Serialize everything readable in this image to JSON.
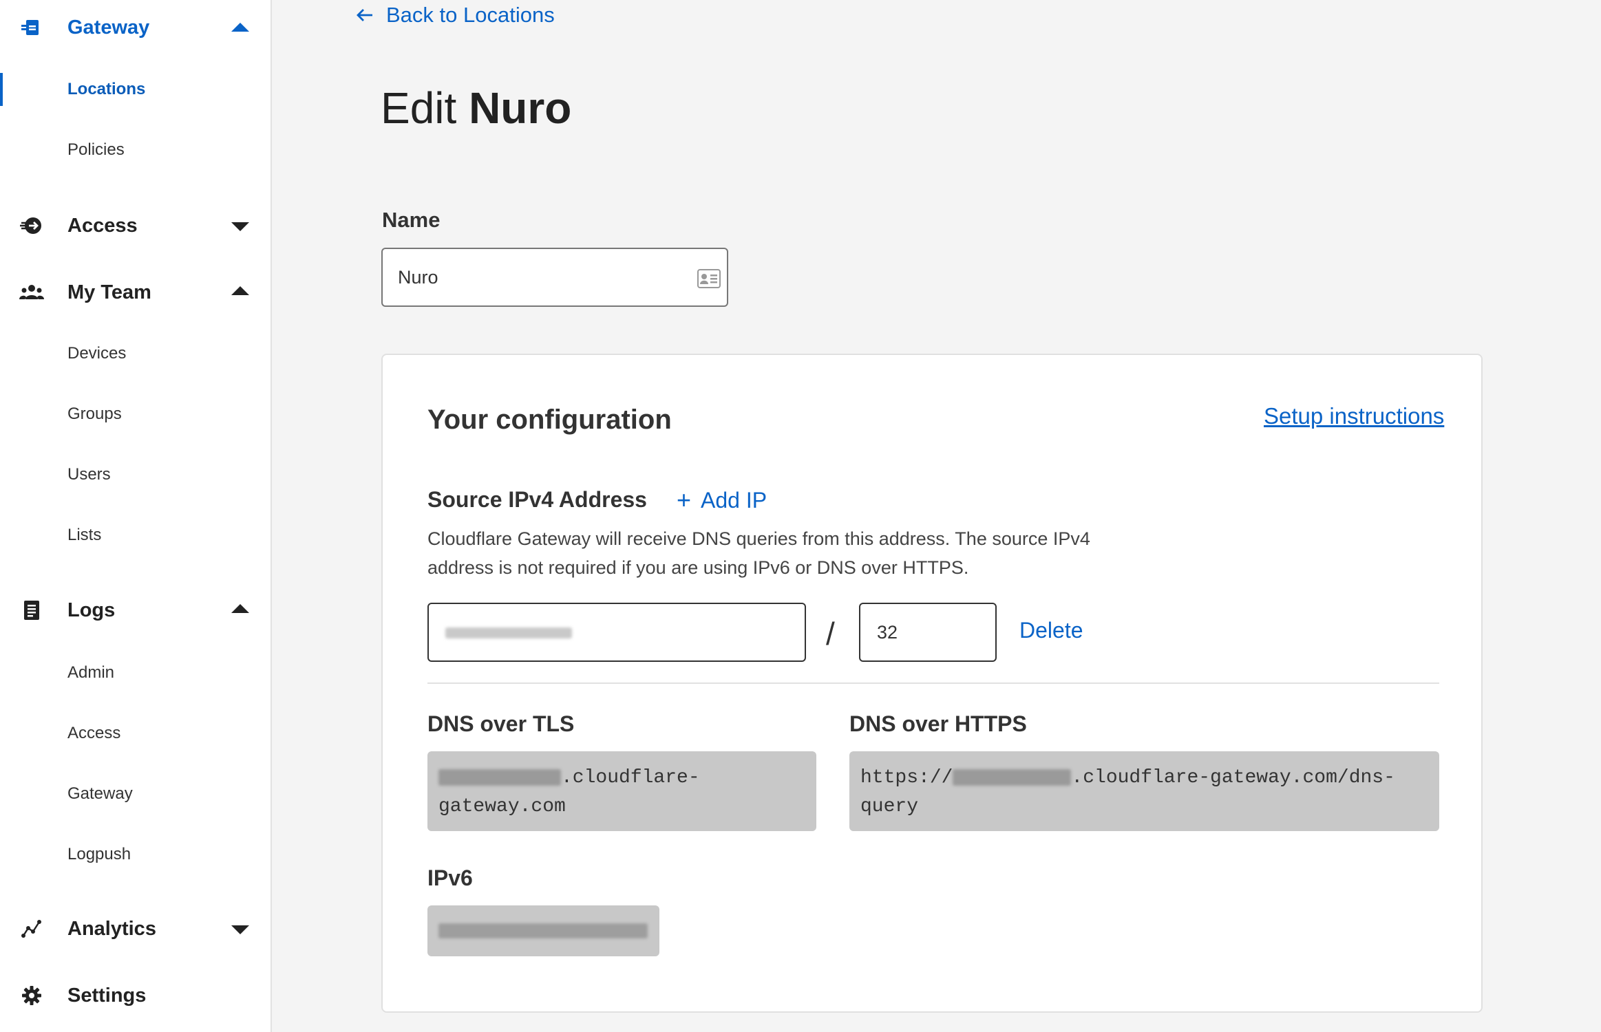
{
  "sidebar": {
    "gateway": {
      "label": "Gateway",
      "icon": "gateway-icon",
      "expanded": true,
      "items": [
        {
          "label": "Locations",
          "active": true
        },
        {
          "label": "Policies"
        }
      ]
    },
    "access": {
      "label": "Access",
      "icon": "access-icon",
      "expanded": false
    },
    "my_team": {
      "label": "My Team",
      "icon": "team-icon",
      "expanded": true,
      "items": [
        {
          "label": "Devices"
        },
        {
          "label": "Groups"
        },
        {
          "label": "Users"
        },
        {
          "label": "Lists"
        }
      ]
    },
    "logs": {
      "label": "Logs",
      "icon": "logs-icon",
      "expanded": true,
      "items": [
        {
          "label": "Admin"
        },
        {
          "label": "Access"
        },
        {
          "label": "Gateway"
        },
        {
          "label": "Logpush"
        }
      ]
    },
    "analytics": {
      "label": "Analytics",
      "icon": "analytics-icon",
      "expanded": false
    },
    "settings": {
      "label": "Settings",
      "icon": "gear-icon"
    }
  },
  "main": {
    "back_link": "Back to Locations",
    "title_prefix": "Edit",
    "title_name": "Nuro",
    "name_label": "Name",
    "name_value": "Nuro",
    "config": {
      "title": "Your configuration",
      "setup_link": "Setup instructions",
      "source_label": "Source IPv4 Address",
      "add_ip": "Add IP",
      "description": "Cloudflare Gateway will receive DNS queries from this address. The source IPv4 address is not required if you are using IPv6 or DNS over HTTPS.",
      "cidr_value": "32",
      "delete_label": "Delete",
      "slash": "/",
      "dot_label": "DNS over TLS",
      "dot_line1_suffix": ".cloudflare-",
      "dot_line2": "gateway.com",
      "doh_label": "DNS over HTTPS",
      "doh_prefix": "https://",
      "doh_line1_suffix": ".cloudflare-gateway.com/dns-",
      "doh_line2": "query",
      "ipv6_label": "IPv6"
    }
  },
  "colors": {
    "accent": "#0a63c7",
    "background": "#f4f4f4",
    "code_background": "#c8c8c8"
  }
}
